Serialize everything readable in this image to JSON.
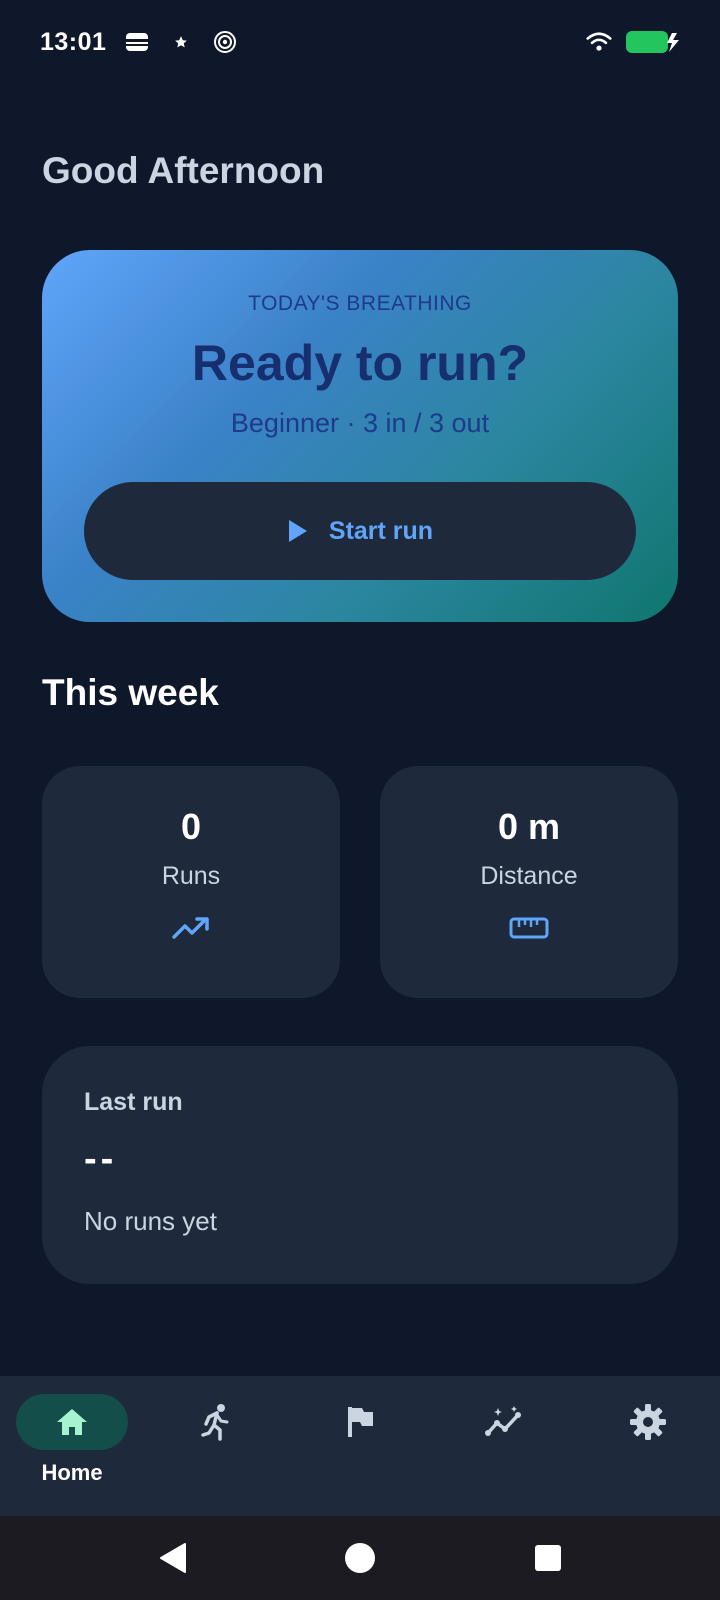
{
  "status_bar": {
    "time": "13:01",
    "left_icons": [
      "wallet-icon",
      "star-icon",
      "spiral-icon"
    ],
    "right_icons": [
      "wifi-icon",
      "battery-charging-icon"
    ],
    "battery_color": "#22c55e"
  },
  "greeting": "Good Afternoon",
  "hero": {
    "eyebrow": "TODAY'S BREATHING",
    "title": "Ready to run?",
    "subtitle": "Beginner · 3 in / 3 out",
    "start_label": "Start run"
  },
  "week": {
    "title": "This week",
    "runs": {
      "value": "0",
      "label": "Runs",
      "icon": "trending-up-icon"
    },
    "distance": {
      "value": "0 m",
      "label": "Distance",
      "icon": "ruler-icon"
    }
  },
  "last_run": {
    "title": "Last run",
    "value": "--",
    "empty_text": "No runs yet"
  },
  "bottom_nav": {
    "items": [
      {
        "label": "Home",
        "icon": "home-icon",
        "active": true
      },
      {
        "label": "",
        "icon": "runner-icon",
        "active": false
      },
      {
        "label": "",
        "icon": "flag-icon",
        "active": false
      },
      {
        "label": "",
        "icon": "insights-icon",
        "active": false
      },
      {
        "label": "",
        "icon": "gear-icon",
        "active": false
      }
    ]
  },
  "colors": {
    "background": "#0f172a",
    "card": "#1e293b",
    "accent_blue": "#60a5fa",
    "accent_teal": "#0f766e",
    "active_pill": "#134e4a"
  }
}
